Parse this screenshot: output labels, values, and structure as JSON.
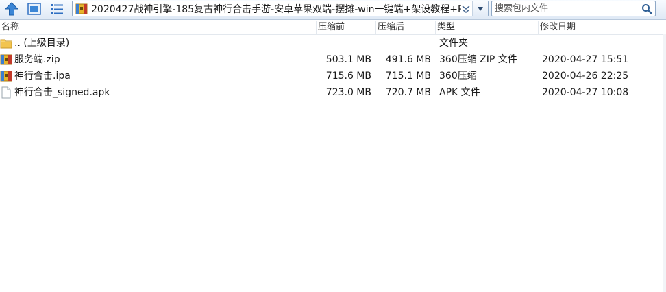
{
  "toolbar": {
    "up_icon": "arrow-up-icon",
    "view_icon": "window-icon",
    "list_icon": "list-view-icon",
    "path": "2020427战神引擎-185复古神行合击手游-安卓苹果双端-摆摊-win一键端+架设教程+P",
    "search_placeholder": "搜索包内文件"
  },
  "columns": {
    "name": "名称",
    "size": "压缩前",
    "packed": "压缩后",
    "type": "类型",
    "date": "修改日期"
  },
  "rows": [
    {
      "name": ".. (上级目录)",
      "icon": "folder-icon",
      "size": "",
      "packed": "",
      "type": "文件夹",
      "date": ""
    },
    {
      "name": "服务端.zip",
      "icon": "archive-icon",
      "size": "503.1 MB",
      "packed": "491.6 MB",
      "type": "360压缩 ZIP 文件",
      "date": "2020-04-27 15:51"
    },
    {
      "name": "神行合击.ipa",
      "icon": "archive-icon",
      "size": "715.6 MB",
      "packed": "715.1 MB",
      "type": "360压缩",
      "date": "2020-04-26 22:25"
    },
    {
      "name": "神行合击_signed.apk",
      "icon": "file-icon",
      "size": "723.0 MB",
      "packed": "720.7 MB",
      "type": "APK 文件",
      "date": "2020-04-27 10:08"
    }
  ],
  "colors": {
    "accent": "#2f6fc2",
    "archive": "#d9a420"
  }
}
